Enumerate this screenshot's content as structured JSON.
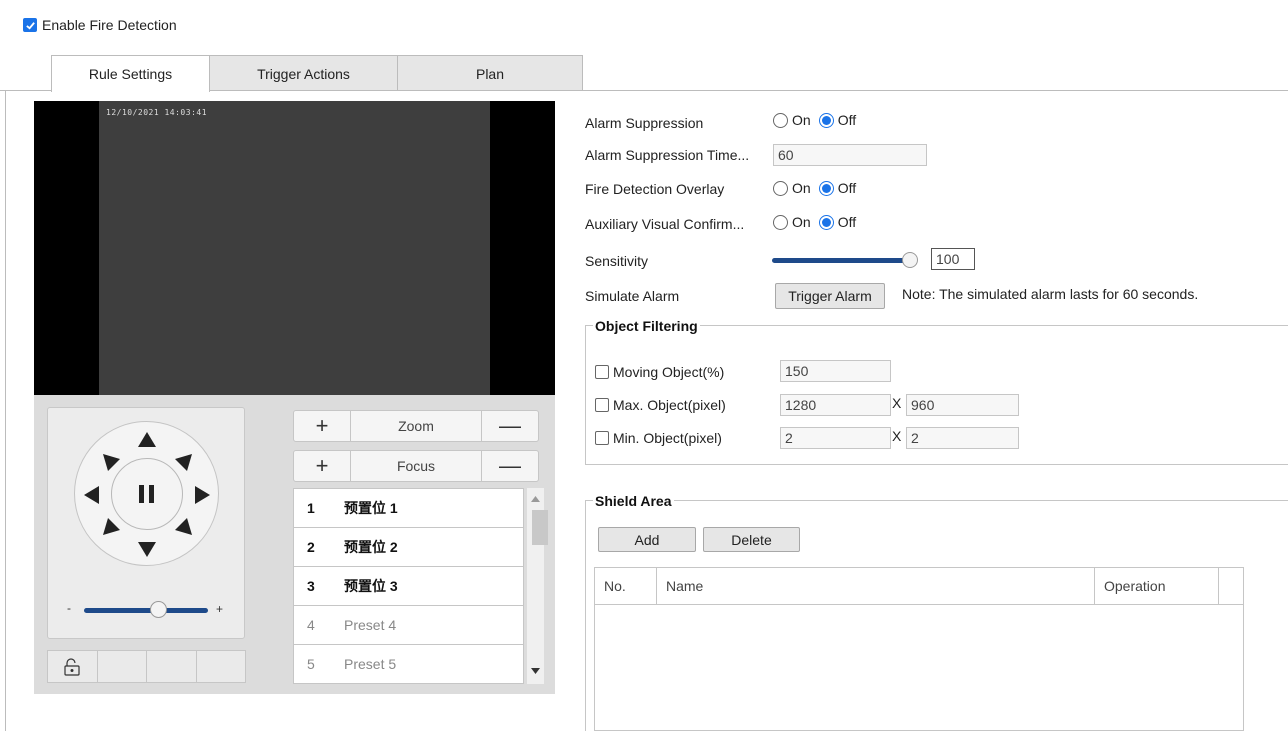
{
  "enable": {
    "label": "Enable Fire Detection",
    "checked": true
  },
  "tabs": [
    {
      "label": "Rule Settings"
    },
    {
      "label": "Trigger Actions"
    },
    {
      "label": "Plan"
    }
  ],
  "video": {
    "timestamp": "12/10/2021 14:03:41"
  },
  "ptz": {
    "zoom_label": "Zoom",
    "focus_label": "Focus",
    "speed_minus": "-",
    "speed_plus": "+",
    "speed_level": 0.55,
    "presets": [
      {
        "num": "1",
        "name": "预置位 1"
      },
      {
        "num": "2",
        "name": "预置位 2"
      },
      {
        "num": "3",
        "name": "预置位 3"
      },
      {
        "num": "4",
        "name": "Preset 4"
      },
      {
        "num": "5",
        "name": "Preset 5"
      }
    ]
  },
  "form": {
    "alarm_suppression": {
      "label": "Alarm Suppression",
      "on": "On",
      "off": "Off",
      "value": "Off"
    },
    "alarm_suppression_time": {
      "label": "Alarm Suppression Time...",
      "value": "60"
    },
    "fire_overlay": {
      "label": "Fire Detection Overlay",
      "on": "On",
      "off": "Off",
      "value": "Off"
    },
    "aux_visual": {
      "label": "Auxiliary Visual Confirm...",
      "on": "On",
      "off": "Off",
      "value": "Off"
    },
    "sensitivity": {
      "label": "Sensitivity",
      "value": "100"
    },
    "simulate": {
      "label": "Simulate Alarm",
      "button": "Trigger Alarm",
      "note": "Note: The simulated alarm lasts for 60 seconds."
    }
  },
  "object_filtering": {
    "title": "Object Filtering",
    "moving": {
      "label": "Moving Object(%)",
      "value": "150"
    },
    "max": {
      "label": "Max. Object(pixel)",
      "w": "1280",
      "x": "X",
      "h": "960"
    },
    "min": {
      "label": "Min. Object(pixel)",
      "w": "2",
      "x": "X",
      "h": "2"
    }
  },
  "shield_area": {
    "title": "Shield Area",
    "add": "Add",
    "delete": "Delete",
    "columns": [
      "No.",
      "Name",
      "Operation"
    ]
  },
  "colors": {
    "accent": "#1a73e8",
    "slider": "#1e4a8a"
  }
}
